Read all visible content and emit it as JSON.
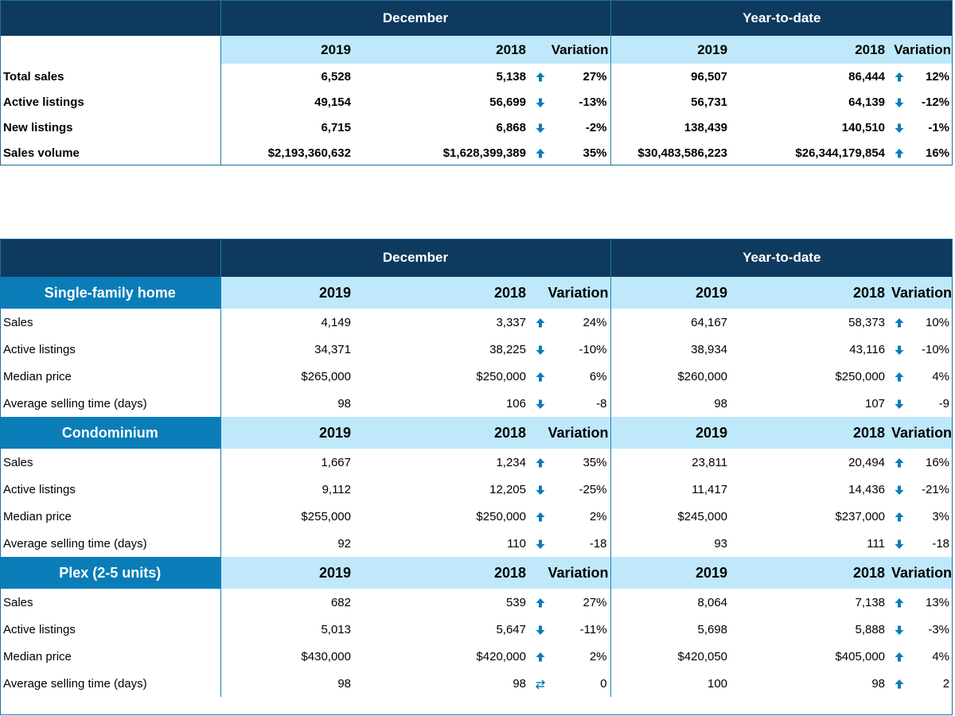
{
  "summary": {
    "header": {
      "month": "December",
      "ytd": "Year-to-date"
    },
    "subheader": {
      "y2019": "2019",
      "y2018": "2018",
      "variation": "Variation"
    },
    "rows": [
      {
        "label": "Total sales",
        "dec_2019": "6,528",
        "dec_2018": "5,138",
        "dec_dir": "up",
        "dec_var": "27%",
        "ytd_2019": "96,507",
        "ytd_2018": "86,444",
        "ytd_dir": "up",
        "ytd_var": "12%"
      },
      {
        "label": "Active listings",
        "dec_2019": "49,154",
        "dec_2018": "56,699",
        "dec_dir": "down",
        "dec_var": "-13%",
        "ytd_2019": "56,731",
        "ytd_2018": "64,139",
        "ytd_dir": "down",
        "ytd_var": "-12%"
      },
      {
        "label": "New listings",
        "dec_2019": "6,715",
        "dec_2018": "6,868",
        "dec_dir": "down",
        "dec_var": "-2%",
        "ytd_2019": "138,439",
        "ytd_2018": "140,510",
        "ytd_dir": "down",
        "ytd_var": "-1%"
      },
      {
        "label": "Sales volume",
        "dec_2019": "$2,193,360,632",
        "dec_2018": "$1,628,399,389",
        "dec_dir": "up",
        "dec_var": "35%",
        "ytd_2019": "$30,483,586,223",
        "ytd_2018": "$26,344,179,854",
        "ytd_dir": "up",
        "ytd_var": "16%"
      }
    ]
  },
  "by_type": {
    "header": {
      "month": "December",
      "ytd": "Year-to-date"
    },
    "subheader": {
      "y2019": "2019",
      "y2018": "2018",
      "variation": "Variation"
    },
    "sections": [
      {
        "title": "Single-family home",
        "rows": [
          {
            "label": "Sales",
            "dec_2019": "4,149",
            "dec_2018": "3,337",
            "dec_dir": "up",
            "dec_var": "24%",
            "ytd_2019": "64,167",
            "ytd_2018": "58,373",
            "ytd_dir": "up",
            "ytd_var": "10%"
          },
          {
            "label": "Active listings",
            "dec_2019": "34,371",
            "dec_2018": "38,225",
            "dec_dir": "down",
            "dec_var": "-10%",
            "ytd_2019": "38,934",
            "ytd_2018": "43,116",
            "ytd_dir": "down",
            "ytd_var": "-10%"
          },
          {
            "label": "Median price",
            "dec_2019": "$265,000",
            "dec_2018": "$250,000",
            "dec_dir": "up",
            "dec_var": "6%",
            "ytd_2019": "$260,000",
            "ytd_2018": "$250,000",
            "ytd_dir": "up",
            "ytd_var": "4%"
          },
          {
            "label": "Average selling time (days)",
            "dec_2019": "98",
            "dec_2018": "106",
            "dec_dir": "down",
            "dec_var": "-8",
            "ytd_2019": "98",
            "ytd_2018": "107",
            "ytd_dir": "down",
            "ytd_var": "-9"
          }
        ]
      },
      {
        "title": "Condominium",
        "rows": [
          {
            "label": "Sales",
            "dec_2019": "1,667",
            "dec_2018": "1,234",
            "dec_dir": "up",
            "dec_var": "35%",
            "ytd_2019": "23,811",
            "ytd_2018": "20,494",
            "ytd_dir": "up",
            "ytd_var": "16%"
          },
          {
            "label": "Active listings",
            "dec_2019": "9,112",
            "dec_2018": "12,205",
            "dec_dir": "down",
            "dec_var": "-25%",
            "ytd_2019": "11,417",
            "ytd_2018": "14,436",
            "ytd_dir": "down",
            "ytd_var": "-21%"
          },
          {
            "label": "Median price",
            "dec_2019": "$255,000",
            "dec_2018": "$250,000",
            "dec_dir": "up",
            "dec_var": "2%",
            "ytd_2019": "$245,000",
            "ytd_2018": "$237,000",
            "ytd_dir": "up",
            "ytd_var": "3%"
          },
          {
            "label": "Average selling time (days)",
            "dec_2019": "92",
            "dec_2018": "110",
            "dec_dir": "down",
            "dec_var": "-18",
            "ytd_2019": "93",
            "ytd_2018": "111",
            "ytd_dir": "down",
            "ytd_var": "-18"
          }
        ]
      },
      {
        "title": "Plex (2-5 units)",
        "rows": [
          {
            "label": "Sales",
            "dec_2019": "682",
            "dec_2018": "539",
            "dec_dir": "up",
            "dec_var": "27%",
            "ytd_2019": "8,064",
            "ytd_2018": "7,138",
            "ytd_dir": "up",
            "ytd_var": "13%"
          },
          {
            "label": "Active listings",
            "dec_2019": "5,013",
            "dec_2018": "5,647",
            "dec_dir": "down",
            "dec_var": "-11%",
            "ytd_2019": "5,698",
            "ytd_2018": "5,888",
            "ytd_dir": "down",
            "ytd_var": "-3%"
          },
          {
            "label": "Median price",
            "dec_2019": "$430,000",
            "dec_2018": "$420,000",
            "dec_dir": "up",
            "dec_var": "2%",
            "ytd_2019": "$420,050",
            "ytd_2018": "$405,000",
            "ytd_dir": "up",
            "ytd_var": "4%"
          },
          {
            "label": "Average selling time (days)",
            "dec_2019": "98",
            "dec_2018": "98",
            "dec_dir": "same",
            "dec_var": "0",
            "ytd_2019": "100",
            "ytd_2018": "98",
            "ytd_dir": "up",
            "ytd_var": "2"
          }
        ]
      }
    ]
  },
  "icons": {
    "up": "arrow-up-icon",
    "down": "arrow-down-icon",
    "same": "arrows-left-right-icon"
  },
  "colors": {
    "header_dark": "#0e3a5f",
    "section_blue": "#0a7db8",
    "subheader_light": "#bfe9fb",
    "arrow": "#0a7db8"
  }
}
